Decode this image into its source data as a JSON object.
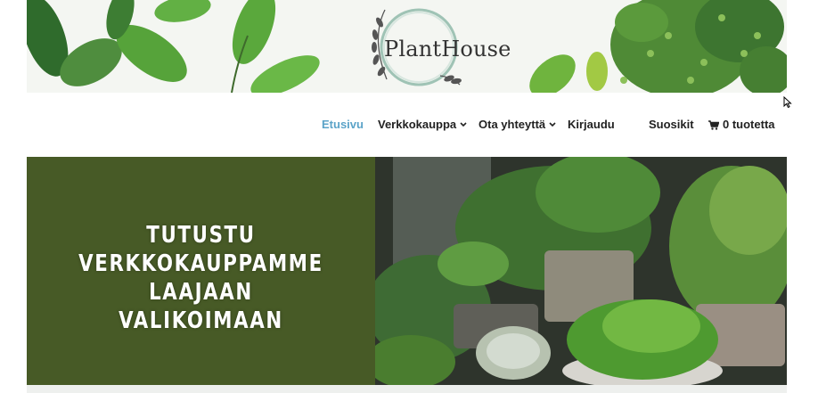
{
  "header": {
    "logo_text": "PlantHouse"
  },
  "nav": {
    "items": [
      {
        "label": "Etusivu",
        "active": true
      },
      {
        "label": "Verkkokauppa",
        "dropdown": true
      },
      {
        "label": "Ota yhteyttä",
        "dropdown": true
      },
      {
        "label": "Kirjaudu"
      }
    ],
    "favorites_label": "Suosikit",
    "cart_label": "0 tuotetta"
  },
  "hero": {
    "title_lines": [
      "TUTUSTU",
      "VERKKOKAUPPAMME",
      "LAAJAAN",
      "VALIKOIMAAN"
    ],
    "left_color": "#475a26"
  },
  "colors": {
    "active_nav": "#5ba3c8",
    "text": "#222222"
  },
  "icons": [
    "chevron-down-icon",
    "cart-icon",
    "mouse-cursor-icon"
  ]
}
